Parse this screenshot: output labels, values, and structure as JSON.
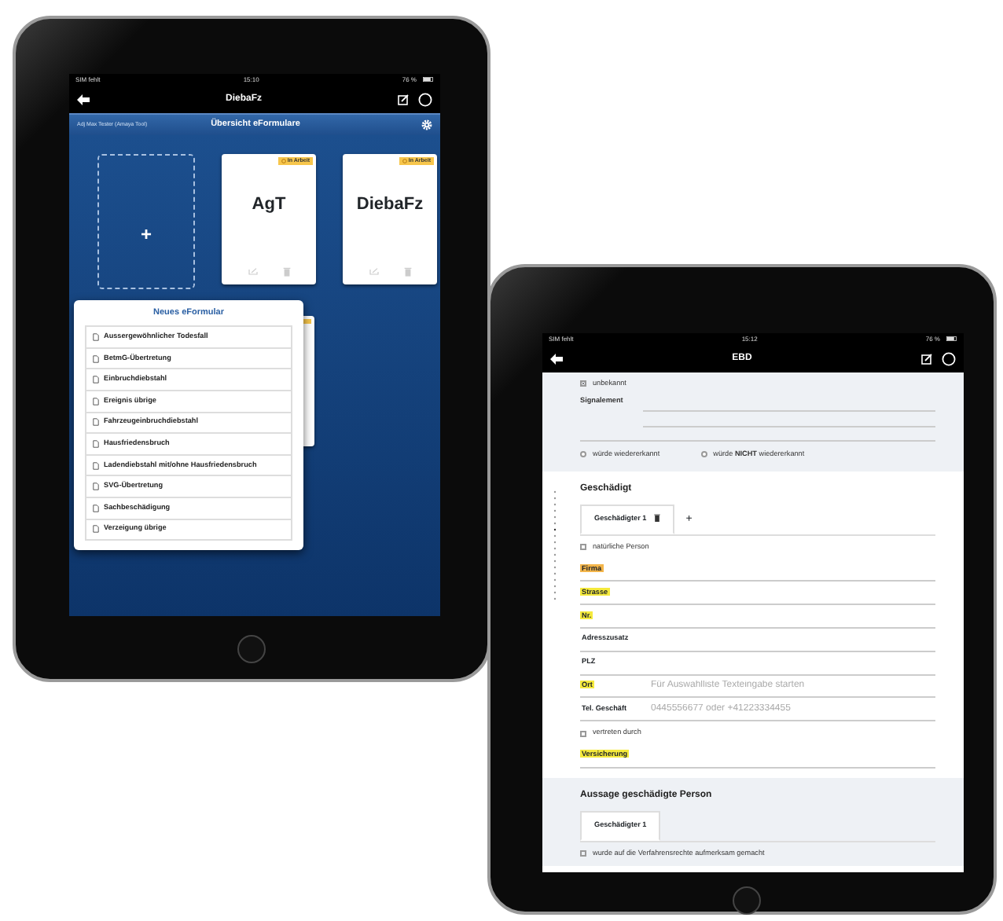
{
  "left_tablet": {
    "status_bar": {
      "carrier": "SIM fehlt",
      "time": "15:10",
      "battery": "76 %"
    },
    "nav_title": "DiebaFz",
    "header": {
      "breadcrumb": "Adj Max Tester (Amaya Tool)",
      "title": "Übersicht eFormulare"
    },
    "add_card": {
      "label": "+"
    },
    "forms": [
      {
        "title": "AgT",
        "status": "In Arbeit"
      },
      {
        "title": "DiebaFz",
        "status": "In Arbeit"
      }
    ],
    "popup": {
      "title": "Neues eFormular",
      "items": [
        "Aussergewöhnlicher Todesfall",
        "BetmG-Übertretung",
        "Einbruchdiebstahl",
        "Ereignis übrige",
        "Fahrzeugeinbruchdiebstahl",
        "Hausfriedensbruch",
        "Ladendiebstahl mit/ohne Hausfriedensbruch",
        "SVG-Übertretung",
        "Sachbeschädigung",
        "Verzeigung übrige"
      ]
    }
  },
  "right_tablet": {
    "status_bar": {
      "carrier": "SIM fehlt",
      "time": "15:12",
      "battery": "76 %"
    },
    "nav_title": "EBD",
    "unknown": {
      "label": "unbekannt",
      "checked": true
    },
    "signalement": {
      "label": "Signalement"
    },
    "recognition": [
      {
        "label": "würde wiedererkannt",
        "selected": false
      },
      {
        "label": "würde **NICHT** wiedererkannt",
        "selected": false
      }
    ],
    "sections": [
      {
        "title": "Geschädigt",
        "tabs": [
          {
            "label": "Geschädigter 1",
            "selected": true
          }
        ],
        "add_tab": "+",
        "rows": [
          {
            "kind": "checkbox",
            "label": "natürliche Person",
            "checked": false
          },
          {
            "kind": "field",
            "label": "Firma",
            "color": "#f3b54a"
          },
          {
            "kind": "field",
            "label": "Strasse",
            "color": "#f5ea3c"
          },
          {
            "kind": "field",
            "label": "Nr.",
            "color": "#f5ea3c"
          },
          {
            "kind": "field",
            "label": "Adresszusatz"
          },
          {
            "kind": "field",
            "label": "PLZ"
          },
          {
            "kind": "field",
            "label": "Ort",
            "color": "#f5ea3c",
            "placeholder": "Für Auswahlliste Texteingabe starten"
          },
          {
            "kind": "field",
            "label": "Tel. Geschäft",
            "placeholder": "0445556677 oder +41223334455"
          },
          {
            "kind": "checkbox",
            "label": "vertreten durch",
            "checked": false
          },
          {
            "kind": "field",
            "label": "Versicherung",
            "color": "#f5ea3c"
          }
        ]
      },
      {
        "title": "Aussage geschädigte Person",
        "tabs": [
          {
            "label": "Geschädigter 1",
            "selected": true
          }
        ],
        "rows": [
          {
            "kind": "checkbox",
            "label": "wurde auf die Verfahrensrechte aufmerksam gemacht",
            "checked": false
          }
        ]
      }
    ]
  }
}
